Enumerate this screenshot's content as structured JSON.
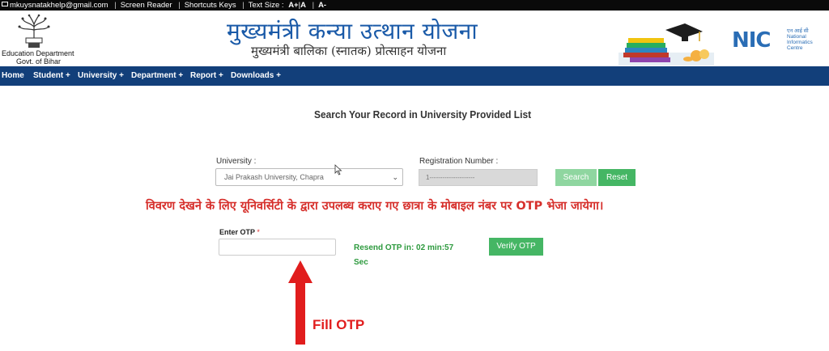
{
  "topbar": {
    "email": "mkuysnatakhelp@gmail.com",
    "screen_reader": "Screen Reader",
    "shortcuts": "Shortcuts Keys",
    "text_size_label": "Text Size :",
    "text_size_plus": "A+",
    "text_size_normal": "A",
    "text_size_minus": "A-"
  },
  "header": {
    "dept_line1": "Education Department",
    "dept_line2": "Govt. of Bihar",
    "title": "मुख्यमंत्री कन्या उत्थान योजना",
    "subtitle": "मुख्यमंत्री बालिका (स्नातक) प्रोत्साहन योजना",
    "nic_short": "NIC",
    "nic_hindi": "एन आई सी",
    "nic_full": "National Informatics Centre"
  },
  "nav": {
    "items": [
      "Home",
      "Student +",
      "University +",
      "Department +",
      "Report +",
      "Downloads +"
    ]
  },
  "main": {
    "page_title": "Search Your Record in University Provided List",
    "university_label": "University :",
    "university_value": "Jai Prakash University, Chapra",
    "registration_label": "Registration Number :",
    "registration_value": "1---------------------",
    "search_label": "Search",
    "reset_label": "Reset",
    "notice": "विवरण देखने के लिए यूनिवर्सिटी के द्वारा उपलब्ध कराए गए छात्रा के मोबाइल नंबर पर OTP भेजा जायेगा।",
    "otp_label": "Enter OTP",
    "otp_required": "*",
    "otp_value": "",
    "resend_text": "Resend OTP in: 02 min:57 Sec",
    "verify_label": "Verify OTP"
  },
  "annotation": {
    "text": "Fill OTP",
    "color": "#e11d1d"
  },
  "colors": {
    "navbar": "#123f7a",
    "title": "#1a5aa8",
    "button_green": "#45b664",
    "notice_red": "#d6302c"
  }
}
